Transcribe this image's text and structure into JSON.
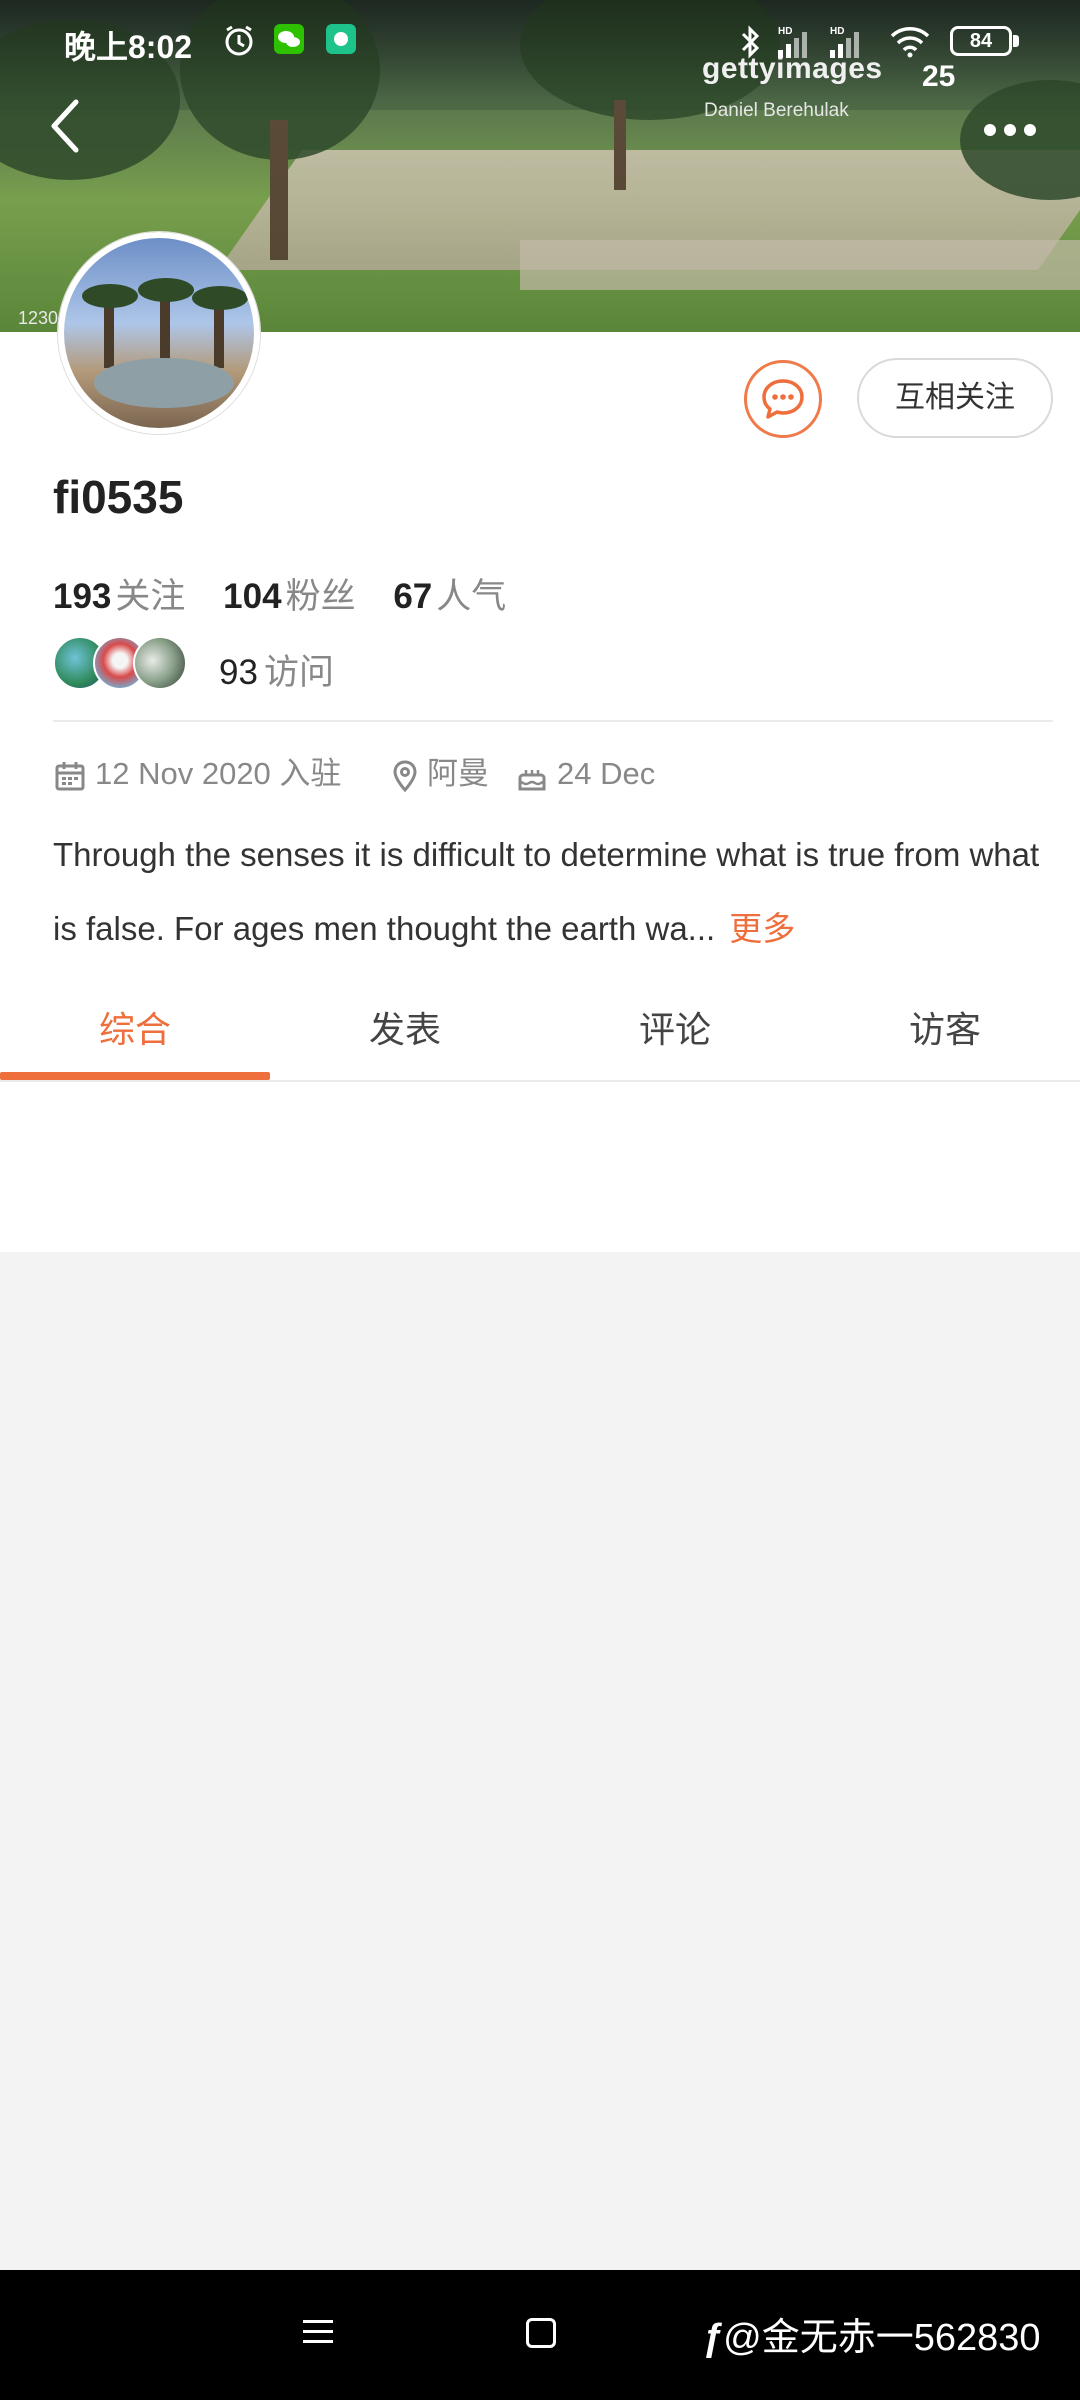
{
  "status_bar": {
    "time": "晚上8:02",
    "battery": "84",
    "icons": [
      "alarm-icon",
      "wechat-icon",
      "app-notification-icon",
      "bluetooth-icon",
      "signal-hd-icon",
      "signal-hd-icon",
      "wifi-icon",
      "battery-icon"
    ]
  },
  "banner": {
    "watermark": "gettyimages",
    "watermark_credit": "Daniel Berehulak",
    "watermark_years": "25",
    "photo_number": "1230"
  },
  "profile": {
    "username": "fi0535",
    "follow_button": "互相关注",
    "stats": [
      {
        "value": "193",
        "label": "关注"
      },
      {
        "value": "104",
        "label": "粉丝"
      },
      {
        "value": "67",
        "label": "人气"
      }
    ],
    "visits": {
      "value": "93",
      "label": "访问"
    },
    "joined": "12 Nov 2020 入驻",
    "location": "阿曼",
    "birthday": "24 Dec",
    "bio": "Through the senses it is difficult to determine what is true from what is false. For ages men thought the earth wa...",
    "bio_more": "更多"
  },
  "tabs": [
    {
      "label": "综合",
      "active": true
    },
    {
      "label": "发表",
      "active": false
    },
    {
      "label": "评论",
      "active": false
    },
    {
      "label": "访客",
      "active": false
    }
  ],
  "nav_bar": {
    "watermark": "@金无赤一562830"
  },
  "colors": {
    "accent": "#ee6e3c",
    "muted_text": "#888888",
    "background": "#f3f3f3"
  }
}
